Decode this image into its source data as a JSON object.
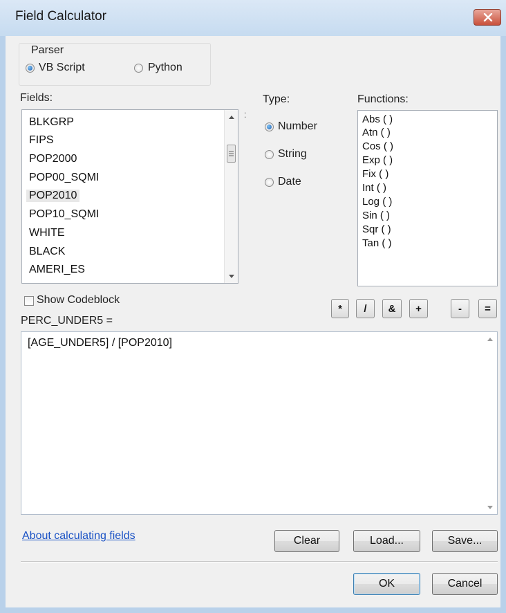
{
  "window": {
    "title": "Field Calculator"
  },
  "parser": {
    "label": "Parser",
    "options": [
      {
        "label": "VB Script",
        "checked": true
      },
      {
        "label": "Python",
        "checked": false
      }
    ]
  },
  "fields": {
    "label": "Fields:",
    "items": [
      "BLKGRP",
      "FIPS",
      "POP2000",
      "POP00_SQMI",
      "POP2010",
      "POP10_SQMI",
      "WHITE",
      "BLACK",
      "AMERI_ES"
    ],
    "selected": "POP2010"
  },
  "type": {
    "label": "Type:",
    "options": [
      {
        "label": "Number",
        "checked": true
      },
      {
        "label": "String",
        "checked": false
      },
      {
        "label": "Date",
        "checked": false
      }
    ]
  },
  "functions": {
    "label": "Functions:",
    "items": [
      "Abs ( )",
      "Atn ( )",
      "Cos ( )",
      "Exp ( )",
      "Fix ( )",
      "Int ( )",
      "Log ( )",
      "Sin ( )",
      "Sqr ( )",
      "Tan ( )"
    ]
  },
  "codeblock": {
    "label": "Show Codeblock",
    "checked": false
  },
  "operators": [
    "*",
    "/",
    "&",
    "+",
    "-",
    "="
  ],
  "expression": {
    "label": "PERC_UNDER5 =",
    "value": "[AGE_UNDER5] / [POP2010]"
  },
  "buttons": {
    "about": "About calculating fields",
    "clear": "Clear",
    "load": "Load...",
    "save": "Save...",
    "ok": "OK",
    "cancel": "Cancel"
  }
}
